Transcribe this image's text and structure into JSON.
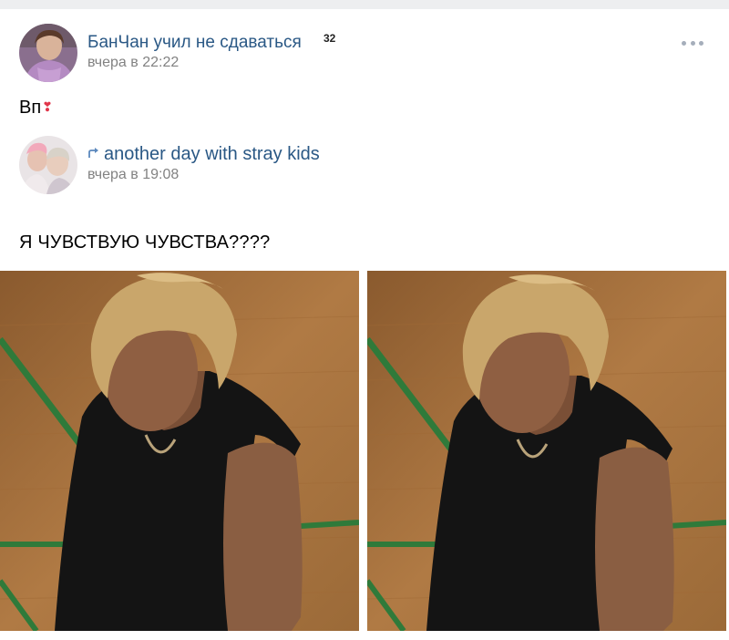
{
  "post": {
    "author": "БанЧан учил не сдаваться",
    "author_badge": "32",
    "time": "вчера в 22:22",
    "text": "Вп",
    "emoji_icon": "heart-exclamation-icon",
    "more_icon": "more-horizontal-icon"
  },
  "repost": {
    "source": "another day with stray kids",
    "time": "вчера в 19:08",
    "text": "Я ЧУВСТВУЮ ЧУВСТВА????",
    "repost_icon": "repost-arrow-icon"
  },
  "colors": {
    "link": "#2a5885",
    "secondary_text": "#828282",
    "header_bg": "#edeef0"
  }
}
